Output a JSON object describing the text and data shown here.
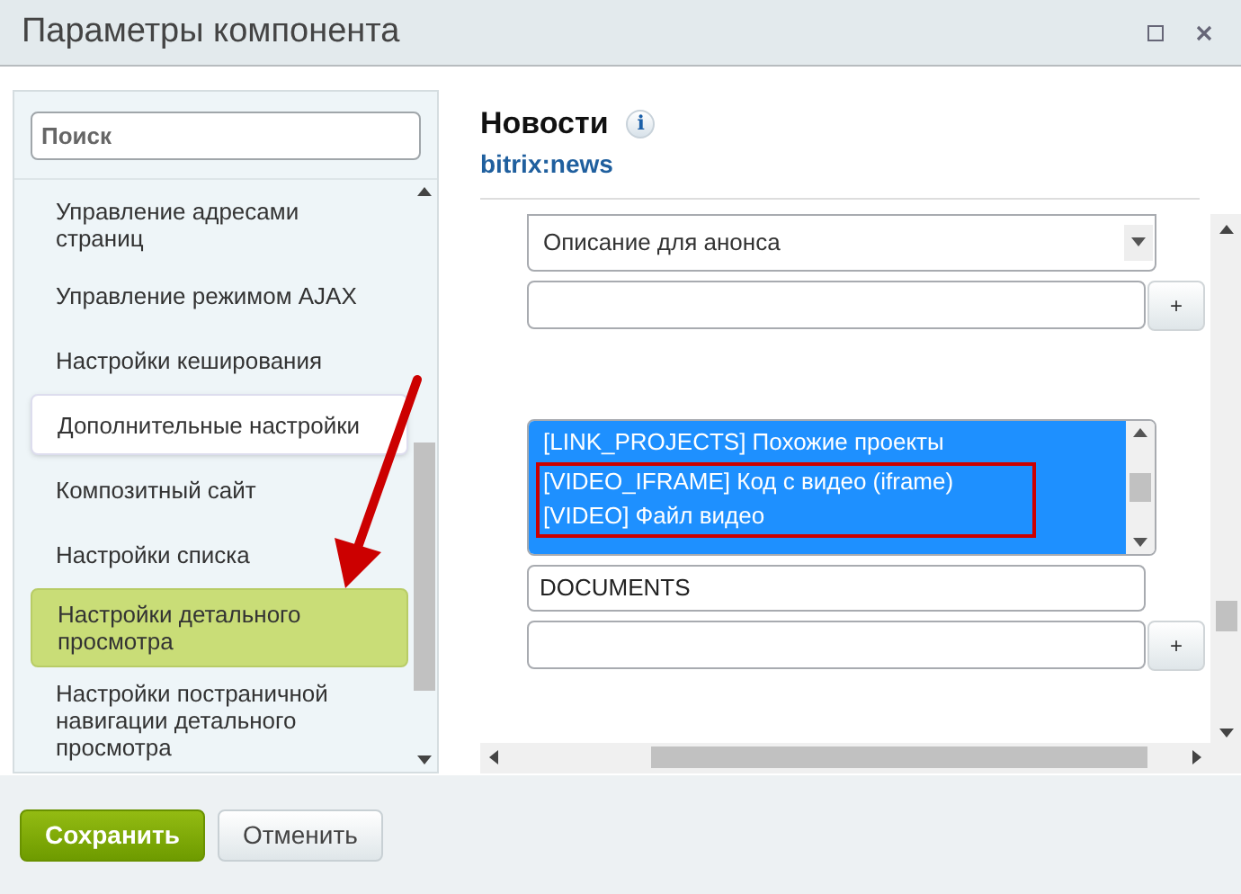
{
  "window": {
    "title": "Параметры компонента"
  },
  "search": {
    "placeholder": "Поиск"
  },
  "sidebar": {
    "items": [
      {
        "label": "Управление адресами страниц",
        "selected": false,
        "highlighted": false
      },
      {
        "label": "Управление режимом AJAX",
        "selected": false,
        "highlighted": false
      },
      {
        "label": "Настройки кеширования",
        "selected": false,
        "highlighted": false
      },
      {
        "label": "Дополнительные настройки",
        "selected": true,
        "highlighted": false
      },
      {
        "label": "Композитный сайт",
        "selected": false,
        "highlighted": false
      },
      {
        "label": "Настройки списка",
        "selected": false,
        "highlighted": false
      },
      {
        "label": "Настройки детального просмотра",
        "selected": false,
        "highlighted": true
      },
      {
        "label": "Настройки постраничной навигации детального просмотра",
        "selected": false,
        "highlighted": false
      }
    ]
  },
  "component": {
    "title": "Новости",
    "info": "i",
    "code": "bitrix:news"
  },
  "fields": [
    {
      "kind": "select",
      "value": "Описание для анонса"
    },
    {
      "kind": "input_add",
      "button": "+"
    },
    {
      "kind": "listbox",
      "options": [
        {
          "label": "[LINK_PROJECTS] Похожие проекты",
          "selected": true,
          "annotated": false
        },
        {
          "label": "[VIDEO_IFRAME] Код с видео (iframe)",
          "selected": true,
          "annotated": true
        },
        {
          "label": "[VIDEO] Файл видео",
          "selected": true,
          "annotated": true
        }
      ]
    },
    {
      "kind": "input",
      "value": "DOCUMENTS"
    },
    {
      "kind": "input_add",
      "button": "+"
    }
  ],
  "buttons": [
    {
      "label": "Сохранить",
      "kind": "primary"
    },
    {
      "label": "Отменить",
      "kind": "secondary"
    }
  ]
}
